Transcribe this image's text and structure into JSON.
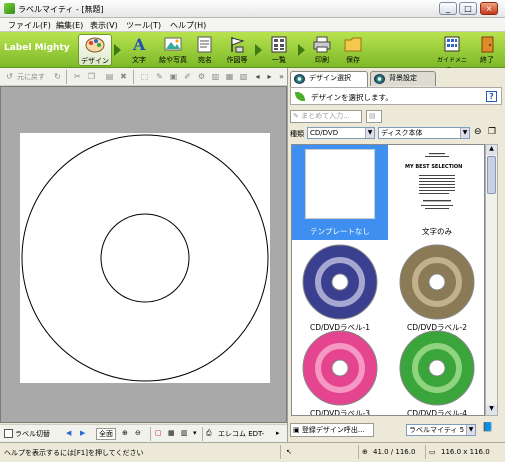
{
  "window": {
    "title": "ラベルマイティ - [無題]",
    "controls": [
      "_",
      "□",
      "×"
    ]
  },
  "menu": [
    "ファイル(F)",
    "編集(E)",
    "表示(V)",
    "ツール(T)",
    "ヘルプ(H)"
  ],
  "brand": "Label Mighty",
  "toolbar": {
    "tools": [
      {
        "label": "デザイン",
        "icon": "design-palette-icon"
      },
      {
        "label": "文字",
        "icon": "text-a-icon"
      },
      {
        "label": "絵や写真",
        "icon": "picture-icon"
      },
      {
        "label": "宛名",
        "icon": "address-card-icon"
      },
      {
        "label": "作図等",
        "icon": "drawing-flag-icon"
      },
      {
        "label": "一覧",
        "icon": "list-grid-icon"
      },
      {
        "label": "印刷",
        "icon": "printer-icon"
      },
      {
        "label": "保存",
        "icon": "folder-icon"
      }
    ],
    "right_tools": [
      {
        "label": "ガイドメニュー",
        "icon": "guide-menu-icon"
      },
      {
        "label": "終了",
        "icon": "exit-door-icon"
      }
    ]
  },
  "edit_toolbar": {
    "undo_label": "元に戻す"
  },
  "canvas": {
    "label_type": "CD/DVD"
  },
  "bottom_toolbar": {
    "switch_label": "ラベル切替",
    "zoom_all_label": "全面",
    "font_label": "エレコム EDT-"
  },
  "right_panel": {
    "tabs": [
      {
        "label": "デザイン選択",
        "selected": true
      },
      {
        "label": "背景設定",
        "selected": false
      }
    ],
    "instruction": "デザインを選択します。",
    "help_label": "?",
    "bulk_button_label": "まとめて入力...",
    "filter": {
      "type_label": "種類",
      "type_value": "CD/DVD",
      "style_value": "ディスク本体"
    },
    "thumbnails": [
      {
        "caption": "テンプレートなし",
        "selected": true,
        "kind": "blank"
      },
      {
        "caption": "文字のみ",
        "selected": false,
        "kind": "text",
        "text_lines": [
          "MY BEST SELECTION"
        ]
      },
      {
        "caption": "CD/DVDラベル-1",
        "selected": false,
        "kind": "disc",
        "color": "#3b3f8f",
        "accent": "#eef"
      },
      {
        "caption": "CD/DVDラベル-2",
        "selected": false,
        "kind": "disc",
        "color": "#8a7a55",
        "accent": "#e6d7b0"
      },
      {
        "caption": "CD/DVDラベル-3",
        "selected": false,
        "kind": "disc",
        "color": "#e5448f",
        "accent": "#ffd1e6"
      },
      {
        "caption": "CD/DVDラベル-4",
        "selected": false,
        "kind": "disc",
        "color": "#3aa53a",
        "accent": "#caf2b0"
      }
    ],
    "register_button_label": "登録デザイン呼出...",
    "registered_combo_value": "ラベルマイティ 5"
  },
  "statusbar": {
    "help_text": "ヘルプを表示するには[F1]を押してください",
    "coords": "41.0 / 116.0",
    "size": "116.0 x 116.0"
  },
  "colors": {
    "toolbar_green": "#8cc63f",
    "selection_blue": "#3f8ff0"
  }
}
